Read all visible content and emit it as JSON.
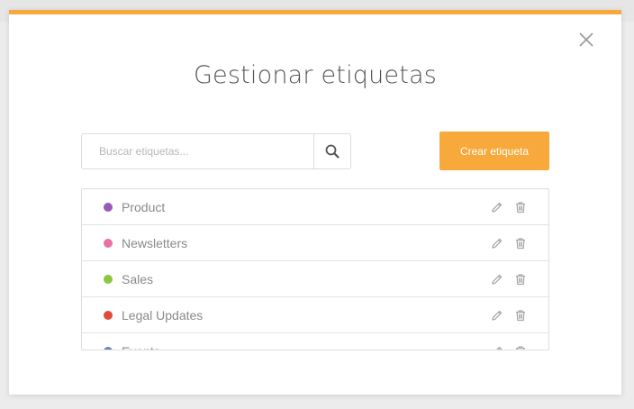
{
  "modal": {
    "title": "Gestionar etiquetas",
    "accent_color": "#f7a93b",
    "close_icon": "close-icon"
  },
  "search": {
    "placeholder": "Buscar etiquetas...",
    "value": "",
    "icon": "search-icon"
  },
  "create_button": {
    "label": "Crear etiqueta"
  },
  "tags": [
    {
      "label": "Product",
      "color": "#9b59b6"
    },
    {
      "label": "Newsletters",
      "color": "#e872a8"
    },
    {
      "label": "Sales",
      "color": "#8dc63f"
    },
    {
      "label": "Legal Updates",
      "color": "#e04c3c"
    },
    {
      "label": "Events",
      "color": "#6c82c4"
    }
  ],
  "row_actions": {
    "edit_icon": "pencil-icon",
    "delete_icon": "trash-icon"
  }
}
